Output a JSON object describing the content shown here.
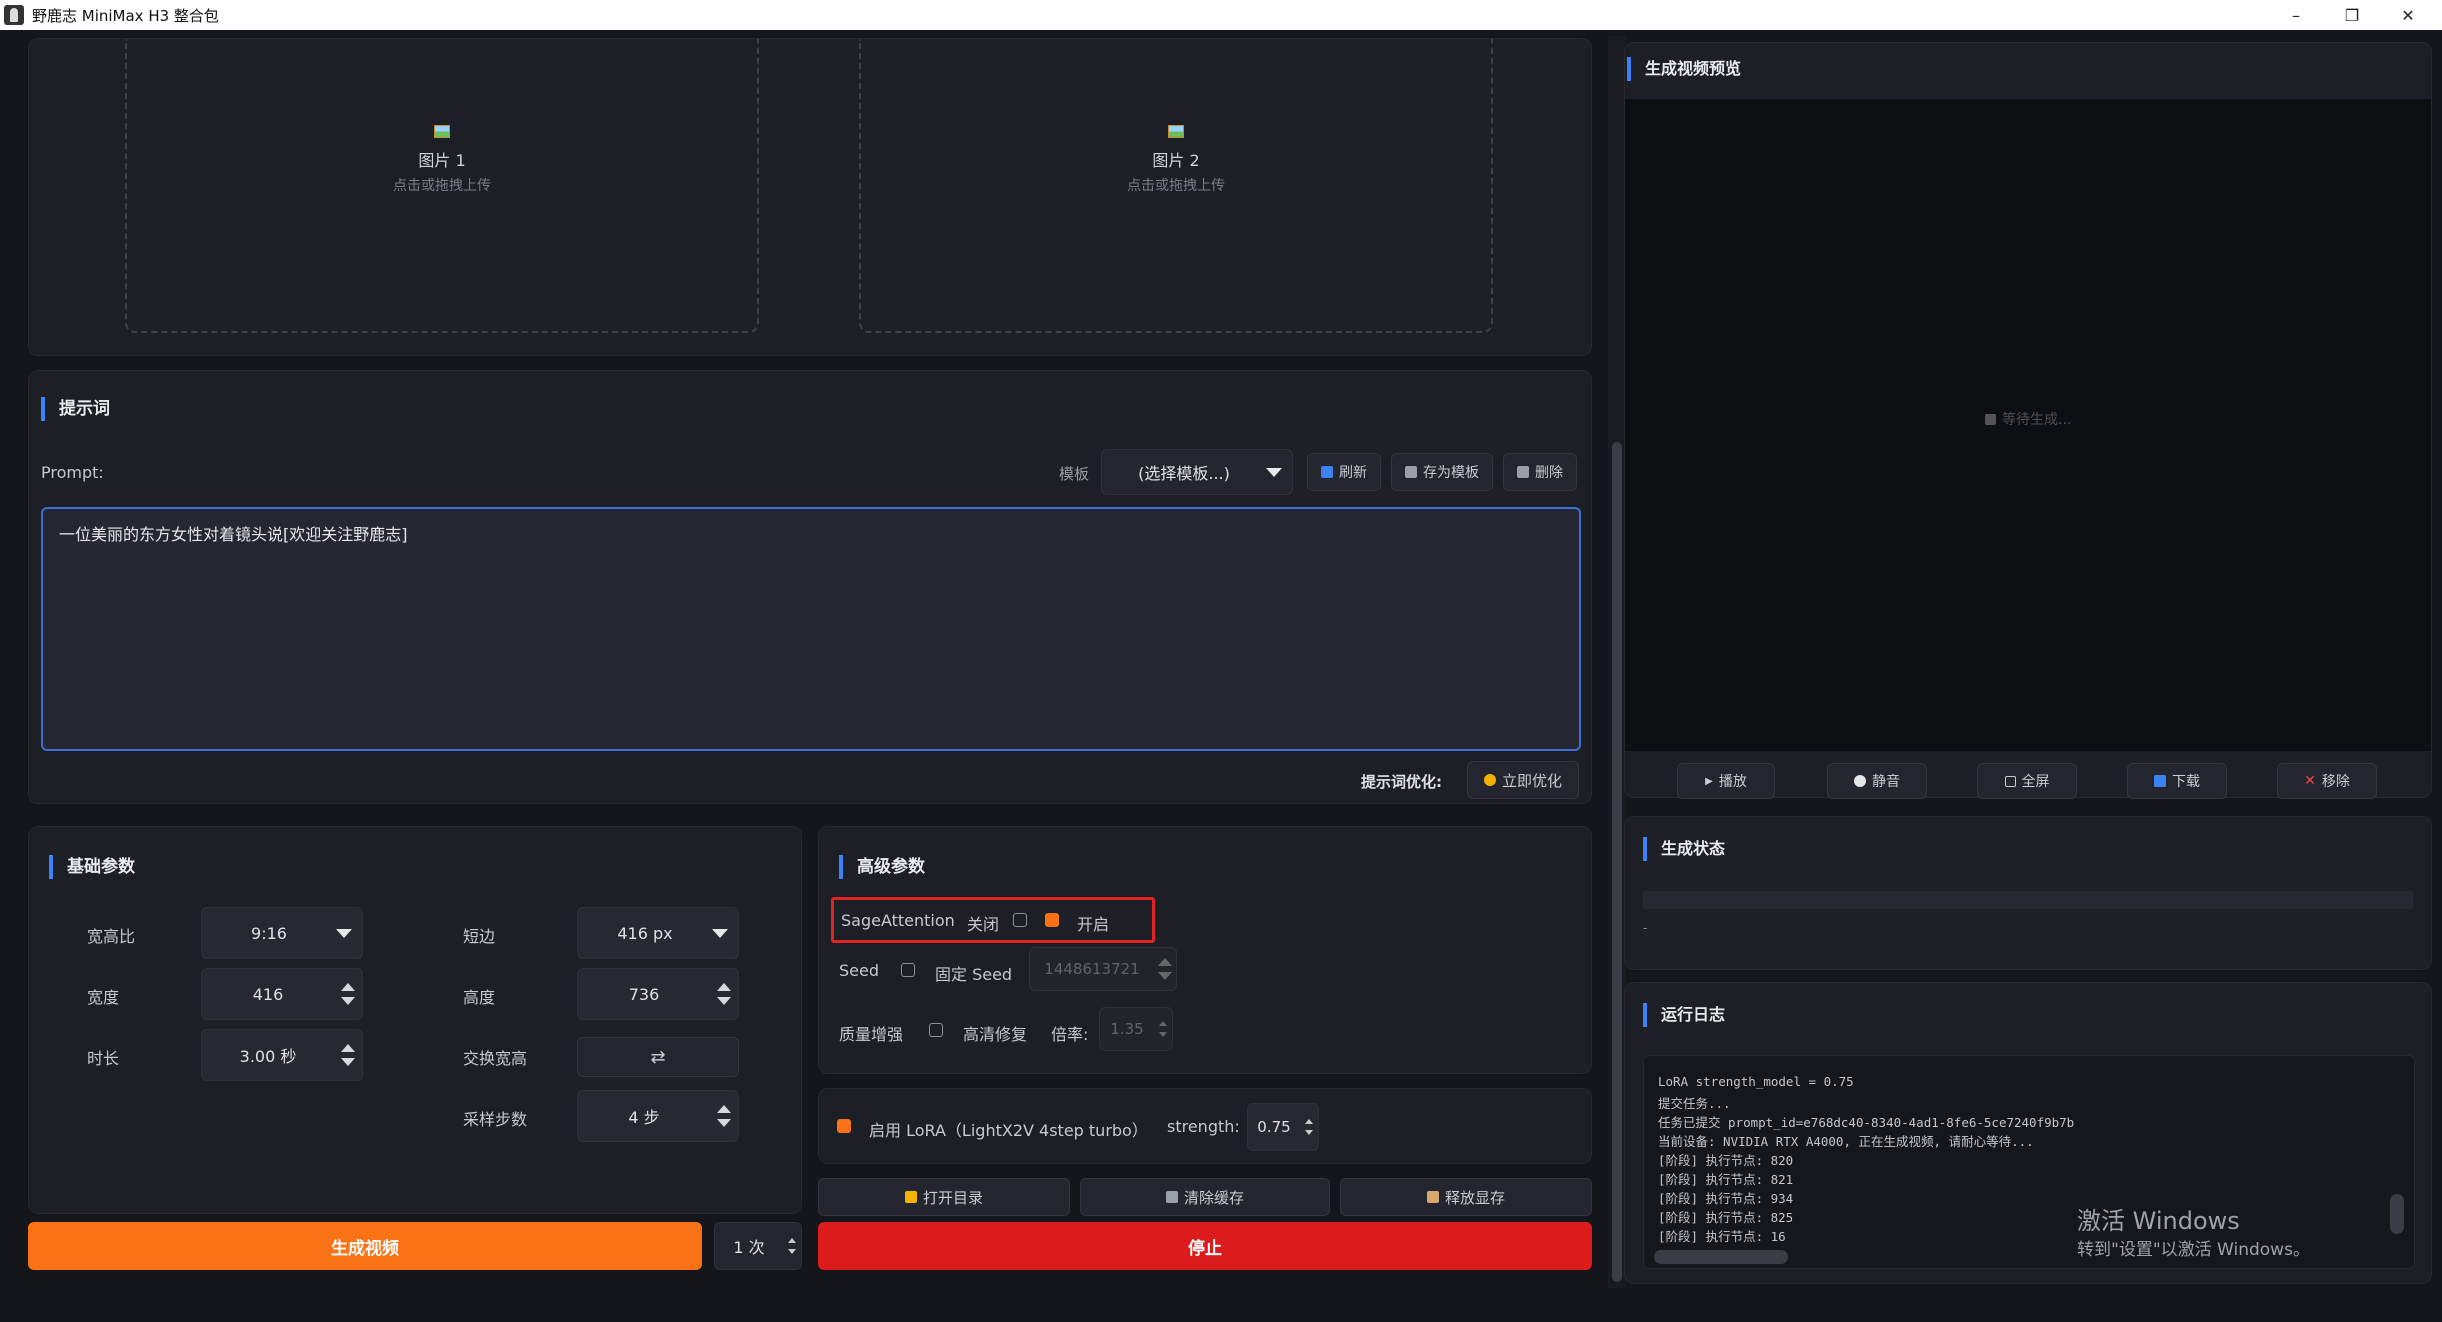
{
  "window": {
    "title": "野鹿志 MiniMax H3 整合包",
    "minimize": "–",
    "restore": "❐",
    "close": "✕"
  },
  "uploads": [
    {
      "label": "图片 1",
      "hint": "点击或拖拽上传"
    },
    {
      "label": "图片 2",
      "hint": "点击或拖拽上传"
    }
  ],
  "prompt": {
    "section_title": "提示词",
    "label": "Prompt:",
    "template_label": "模板",
    "template_value": "(选择模板...)",
    "refresh": "刷新",
    "save_template": "存为模板",
    "delete": "删除",
    "text": "一位美丽的东方女性对着镜头说[欢迎关注野鹿志]",
    "optimize_label": "提示词优化:",
    "optimize_button": "立即优化"
  },
  "basic": {
    "title": "基础参数",
    "aspect_label": "宽高比",
    "aspect_value": "9:16",
    "short_label": "短边",
    "short_value": "416 px",
    "width_label": "宽度",
    "width_value": "416",
    "height_label": "高度",
    "height_value": "736",
    "duration_label": "时长",
    "duration_value": "3.00 秒",
    "swap_label": "交换宽高",
    "swap_icon": "⇄",
    "steps_label": "采样步数",
    "steps_value": "4 步"
  },
  "advanced": {
    "title": "高级参数",
    "sage_label": "SageAttention",
    "sage_off": "关闭",
    "sage_on": "开启",
    "seed_label": "Seed",
    "fixed_seed": "固定 Seed",
    "seed_value": "1448613721",
    "quality_label": "质量增强",
    "hd_repair": "高清修复",
    "ratio_label": "倍率:",
    "ratio_value": "1.35",
    "highlight_color": "#e02424"
  },
  "lora": {
    "label": "启用 LoRA（LightX2V 4step turbo）",
    "strength_label": "strength:",
    "strength_value": "0.75"
  },
  "actions": {
    "open_dir": "打开目录",
    "clear_cache": "清除缓存",
    "free_vram": "释放显存",
    "generate": "生成视频",
    "count": "1 次",
    "stop": "停止",
    "generate_color": "#f97316",
    "stop_color": "#dc1c1c"
  },
  "preview": {
    "title": "生成视频预览",
    "waiting": "等待生成...",
    "play": "播放",
    "mute": "静音",
    "fullscreen": "全屏",
    "download": "下载",
    "remove": "移除"
  },
  "status": {
    "title": "生成状态",
    "text": "-"
  },
  "log": {
    "title": "运行日志",
    "lines": [
      "LoRA strength_model = 0.75",
      "提交任务...",
      "任务已提交 prompt_id=e768dc40-8340-4ad1-8fe6-5ce7240f9b7b",
      "当前设备: NVIDIA RTX A4000, 正在生成视频, 请耐心等待...",
      "[阶段] 执行节点: 820",
      "[阶段] 执行节点: 821",
      "[阶段] 执行节点: 934",
      "[阶段] 执行节点: 825",
      "[阶段] 执行节点: 16"
    ]
  },
  "watermark": {
    "line1": "激活 Windows",
    "line2": "转到\"设置\"以激活 Windows。"
  }
}
